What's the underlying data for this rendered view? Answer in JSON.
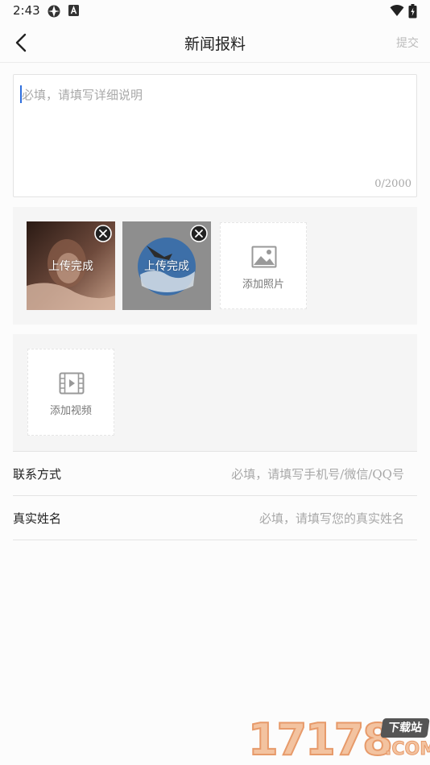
{
  "status_bar": {
    "time": "2:43"
  },
  "nav": {
    "title": "新闻报料",
    "submit_label": "提交"
  },
  "description": {
    "placeholder": "必填，请填写详细说明",
    "counter": "0/2000"
  },
  "photos": {
    "items": [
      {
        "status": "上传完成"
      },
      {
        "status": "上传完成"
      }
    ],
    "add_label": "添加照片"
  },
  "video": {
    "add_label": "添加视频"
  },
  "form": {
    "contact": {
      "label": "联系方式",
      "placeholder": "必填，请填写手机号/微信/QQ号"
    },
    "real_name": {
      "label": "真实姓名",
      "placeholder": "必填，请填写您的真实姓名"
    }
  },
  "watermark": {
    "digits": "17178",
    "badge": "下载站",
    "domain": ".COM"
  },
  "colors": {
    "cursor": "#2f6fdd",
    "placeholder": "#a8a8a8",
    "panel": "#f5f5f5"
  },
  "icons": [
    "vpn-icon",
    "keyboard-a-icon",
    "wifi-icon",
    "battery-icon",
    "back-arrow-icon",
    "close-circle-icon",
    "image-icon",
    "film-play-icon"
  ]
}
